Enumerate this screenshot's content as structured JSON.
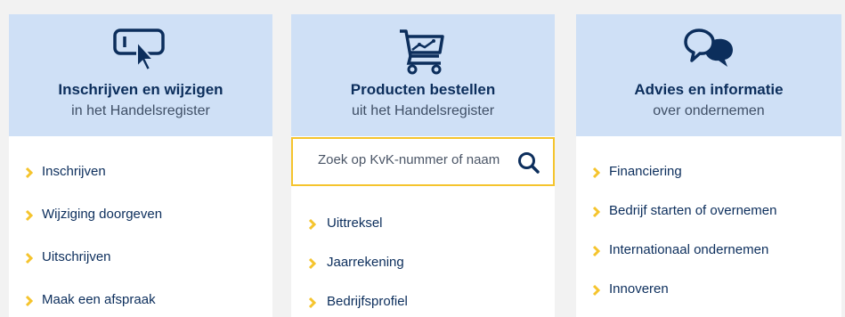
{
  "cards": [
    {
      "icon": "cursor-click-icon",
      "title": "Inschrijven en wijzigen",
      "subtitle": "in het Handelsregister",
      "links": [
        "Inschrijven",
        "Wijziging doorgeven",
        "Uitschrijven",
        "Maak een afspraak"
      ]
    },
    {
      "icon": "shopping-cart-icon",
      "title": "Producten bestellen",
      "subtitle": "uit het Handelsregister",
      "search": {
        "placeholder": "Zoek op KvK-nummer of naam",
        "icon": "search-icon"
      },
      "links": [
        "Uittreksel",
        "Jaarrekening",
        "Bedrijfsprofiel"
      ]
    },
    {
      "icon": "chat-bubbles-icon",
      "title": "Advies en informatie",
      "subtitle": "over ondernemen",
      "links": [
        "Financiering",
        "Bedrijf starten of overnemen",
        "Internationaal ondernemen",
        "Innoveren"
      ]
    }
  ],
  "colors": {
    "header_bg": "#cfe0f6",
    "navy": "#0c2e5c",
    "accent_yellow": "#f5c42d",
    "page_bg": "#f2f2f2"
  }
}
